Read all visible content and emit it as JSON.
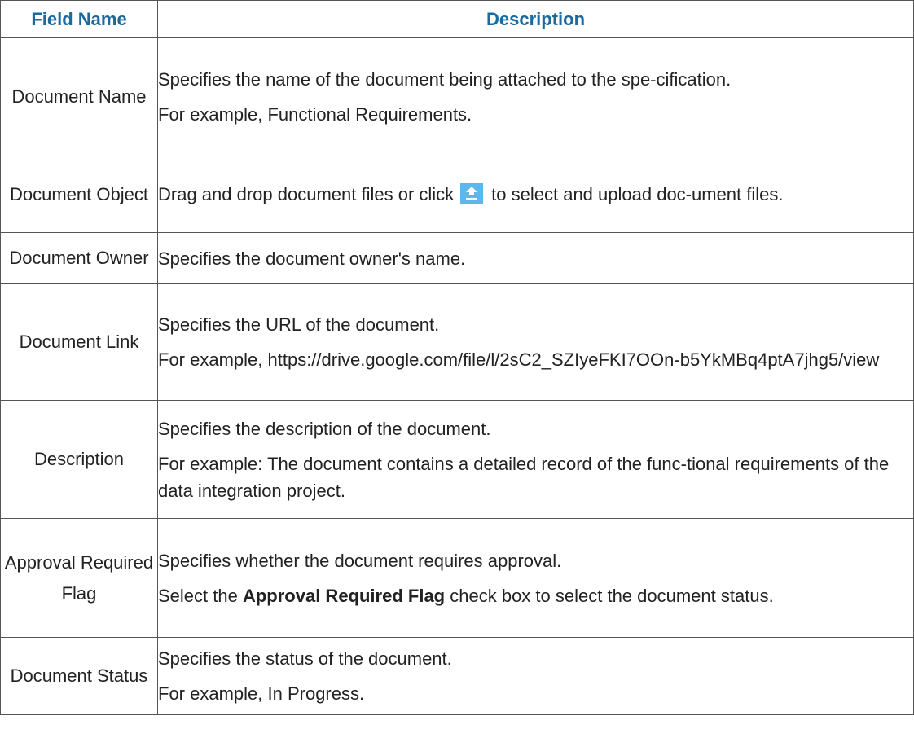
{
  "headers": {
    "field_name": "Field Name",
    "description": "Description"
  },
  "rows": [
    {
      "field": "Document Name",
      "lines": [
        "Specifies the name of the document being attached to the spe-cification.",
        "For example, Functional Requirements."
      ]
    },
    {
      "field": "Document Object",
      "before_icon": "Drag and drop document files or click",
      "after_icon": "to select and upload doc-ument files."
    },
    {
      "field": "Document Owner",
      "lines": [
        "Specifies the document owner's name."
      ]
    },
    {
      "field": "Document Link",
      "lines": [
        "Specifies the URL of the document.",
        "For example, https://drive.google.com/file/l/2sC2_SZIyeFKI7OOn-b5YkMBq4ptA7jhg5/view"
      ]
    },
    {
      "field": "Description",
      "lines": [
        "Specifies the description of the document.",
        "For example: The document contains a detailed record of the func-tional requirements of the data integration project."
      ]
    },
    {
      "field": "Approval Required Flag",
      "lines": [
        "Specifies whether the document requires approval."
      ],
      "select_prefix": "Select the",
      "select_bold": "Approval Required Flag",
      "select_suffix": "check box to select the document status."
    },
    {
      "field": "Document Status",
      "lines": [
        "Specifies the status of the document.",
        "For example, In Progress."
      ]
    }
  ],
  "icons": {
    "upload": "upload-icon"
  },
  "colors": {
    "header_text": "#1a6aa0",
    "icon_bg": "#5bb7ec"
  }
}
